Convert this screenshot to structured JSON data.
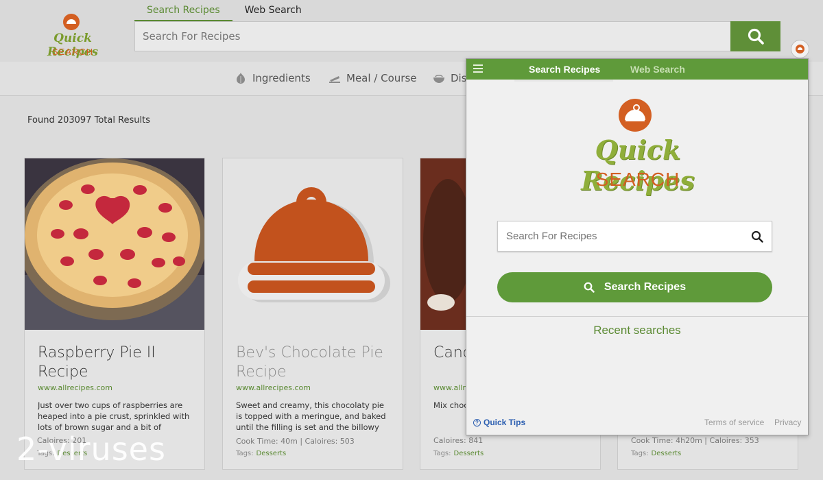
{
  "header": {
    "logo": {
      "script": "Quick Recipes",
      "word": "SEARCH"
    },
    "tabs": [
      {
        "label": "Search Recipes",
        "active": true
      },
      {
        "label": "Web Search",
        "active": false
      }
    ],
    "search": {
      "placeholder": "Search For Recipes"
    },
    "search_button_icon": "search-icon",
    "extension_icon": "quick-recipes-extension-icon"
  },
  "categories": [
    {
      "label": "Ingredients",
      "icon": "garlic-icon"
    },
    {
      "label": "Meal / Course",
      "icon": "dish-icon"
    },
    {
      "label": "Dis",
      "icon": "bowl-icon"
    }
  ],
  "results": {
    "found_text": "Found 203097 Total Results",
    "cards": [
      {
        "title": "Raspberry Pie II Recipe",
        "source": "www.allrecipes.com",
        "description": "Just over two cups of raspberries are heaped into a pie crust, sprinkled with lots of brown sugar and a bit of",
        "meta": "Caloires: 201",
        "tags_label": "Tags:",
        "tag": "Desserts"
      },
      {
        "title": "Bev's Chocolate Pie Recipe",
        "source": "www.allrecipes.com",
        "description": "Sweet and creamy, this chocolaty pie is topped with a meringue, and baked until the filling is set and the billowy",
        "meta": "Cook Time: 40m  |  Caloires: 503",
        "tags_label": "Tags:",
        "tag": "Desserts"
      },
      {
        "title": "Canc Reci",
        "source": "www.allr",
        "description": "Mix choc condens bars to r",
        "meta": "Caloires: 841",
        "tags_label": "Tags:",
        "tag": "Desserts"
      },
      {
        "meta": "Cook Time: 4h20m  |  Caloires: 353",
        "tags_label": "Tags:",
        "tag": "Desserts"
      }
    ]
  },
  "watermark": "2-viruses",
  "popup": {
    "menu_icon": "hamburger-icon",
    "tabs": [
      {
        "label": "Search Recipes",
        "active": true
      },
      {
        "label": "Web Search",
        "active": false
      }
    ],
    "logo": {
      "script": "Quick Recipes",
      "word": "SEARCH"
    },
    "search": {
      "placeholder": "Search For Recipes"
    },
    "button_label": "Search Recipes",
    "recent_label": "Recent searches",
    "quick_tips": "Quick Tips",
    "terms": "Terms of service",
    "privacy": "Privacy"
  },
  "colors": {
    "brand_green": "#5f9a3a",
    "brand_orange": "#d35f22",
    "link_blue": "#2a5db0"
  }
}
